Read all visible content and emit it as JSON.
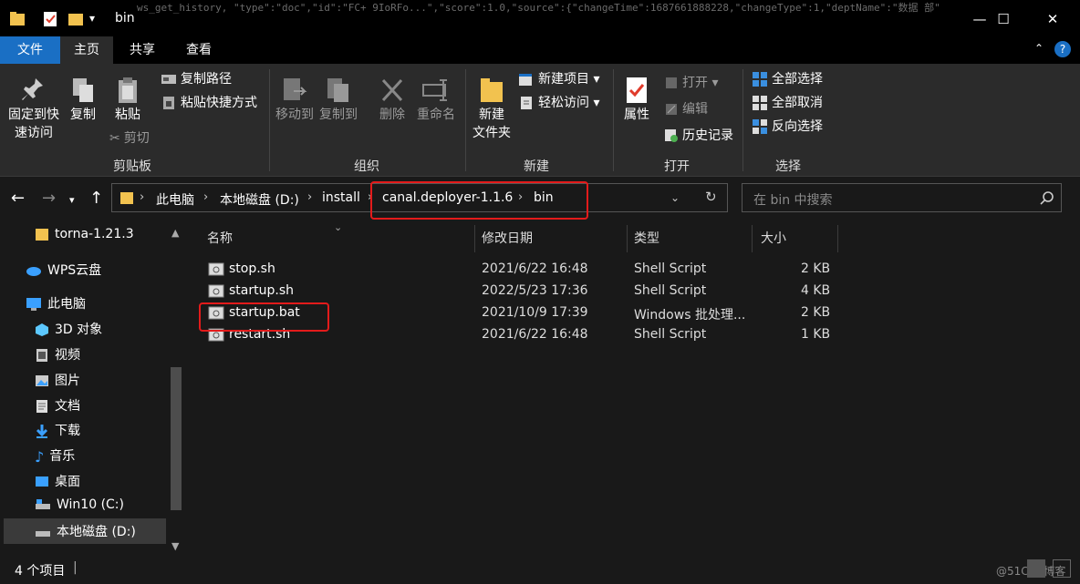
{
  "window": {
    "title": "bin",
    "background_text": "ws_get_history, \"type\":\"doc\",\"id\":\"FC+ 9IoRFo...\",\"score\":1.0,\"source\":{\"changeTime\":1687661888228,\"changeType\":1,\"deptName\":\"数据 部\""
  },
  "tabs": {
    "file": "文件",
    "home": "主页",
    "share": "共享",
    "view": "查看"
  },
  "ribbon": {
    "clipboard": {
      "pin_label_1": "固定到快",
      "pin_label_2": "速访问",
      "copy": "复制",
      "paste": "粘贴",
      "copy_path": "复制路径",
      "paste_shortcut": "粘贴快捷方式",
      "cut": "剪切",
      "group": "剪贴板"
    },
    "organize": {
      "move_to": "移动到",
      "copy_to": "复制到",
      "delete": "删除",
      "rename": "重命名",
      "group": "组织"
    },
    "new": {
      "new_folder_1": "新建",
      "new_folder_2": "文件夹",
      "new_item": "新建项目",
      "easy_access": "轻松访问",
      "group": "新建"
    },
    "open": {
      "properties": "属性",
      "open": "打开",
      "edit": "编辑",
      "history": "历史记录",
      "group": "打开"
    },
    "select": {
      "select_all": "全部选择",
      "select_none": "全部取消",
      "invert": "反向选择",
      "group": "选择"
    }
  },
  "address": {
    "crumbs": [
      "此电脑",
      "本地磁盘 (D:)",
      "install",
      "canal.deployer-1.1.6",
      "bin"
    ],
    "search_placeholder": "在 bin 中搜索"
  },
  "nav": {
    "items": [
      {
        "label": "torna-1.21.3",
        "icon": "folder-icon"
      },
      {
        "label": "WPS云盘",
        "icon": "cloud-icon"
      },
      {
        "label": "此电脑",
        "icon": "computer-icon"
      },
      {
        "label": "3D 对象",
        "icon": "cube-icon"
      },
      {
        "label": "视频",
        "icon": "video-icon"
      },
      {
        "label": "图片",
        "icon": "image-icon"
      },
      {
        "label": "文档",
        "icon": "document-icon"
      },
      {
        "label": "下载",
        "icon": "download-icon"
      },
      {
        "label": "音乐",
        "icon": "music-icon"
      },
      {
        "label": "桌面",
        "icon": "desktop-icon"
      },
      {
        "label": "Win10 (C:)",
        "icon": "drive-icon"
      },
      {
        "label": "本地磁盘 (D:)",
        "icon": "drive-icon"
      }
    ]
  },
  "files": {
    "columns": {
      "name": "名称",
      "date": "修改日期",
      "type": "类型",
      "size": "大小"
    },
    "rows": [
      {
        "name": "stop.sh",
        "date": "2021/6/22 16:48",
        "type": "Shell Script",
        "size": "2 KB"
      },
      {
        "name": "startup.sh",
        "date": "2022/5/23 17:36",
        "type": "Shell Script",
        "size": "4 KB"
      },
      {
        "name": "startup.bat",
        "date": "2021/10/9 17:39",
        "type": "Windows 批处理...",
        "size": "2 KB"
      },
      {
        "name": "restart.sh",
        "date": "2021/6/22 16:48",
        "type": "Shell Script",
        "size": "1 KB"
      }
    ]
  },
  "status": {
    "count": "4 个项目",
    "watermark": "@51CTO博客"
  },
  "colors": {
    "accent": "#1a6fc4",
    "highlight_box": "#e31b1b",
    "folder": "#f2c24f"
  }
}
